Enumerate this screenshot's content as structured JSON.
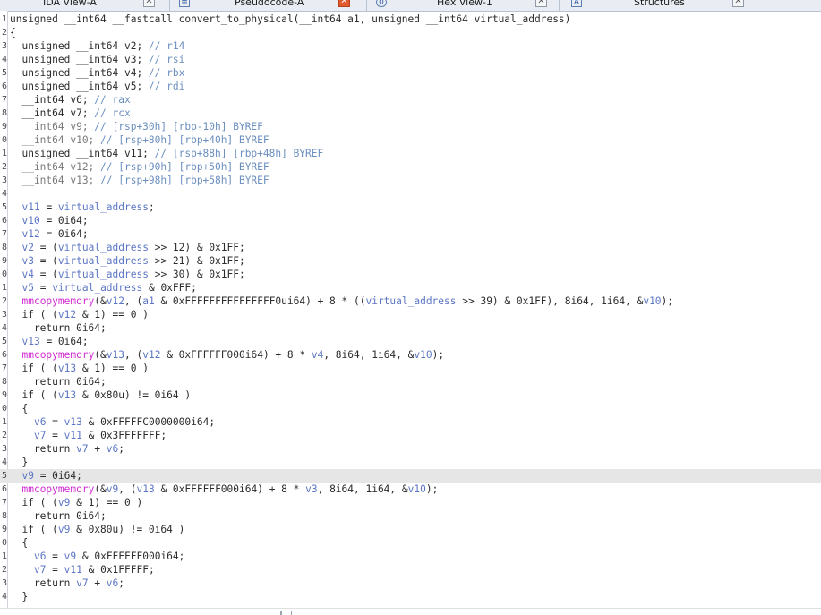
{
  "tabs": [
    {
      "label": "IDA View-A",
      "icon": "ida-view-icon",
      "closable": true,
      "active": false
    },
    {
      "label": "Pseudocode-A",
      "icon": "pseudocode-icon",
      "closable": true,
      "active": true
    },
    {
      "label": "Hex View-1",
      "icon": "hex-view-icon",
      "closable": true,
      "active": false
    },
    {
      "label": "Structures",
      "icon": "structures-icon",
      "closable": true,
      "active": false
    }
  ],
  "colors": {
    "code_text": "#2b2b2b",
    "comment": "#6b8fbf",
    "variable": "#5c76c4",
    "function": "#d12bd1",
    "highlight_line": "#e6e6e6",
    "active_tab_close": "#e25a2b"
  },
  "code": {
    "highlighted_line": 34,
    "lines": [
      {
        "n": "1",
        "parts": [
          [
            "c",
            "unsigned __int64 __fastcall convert_to_physical(__int64 a1, unsigned __int64 virtual_address)"
          ]
        ]
      },
      {
        "n": "2",
        "parts": [
          [
            "c",
            "{"
          ]
        ]
      },
      {
        "n": "3",
        "parts": [
          [
            "c",
            "  unsigned __int64 v2; "
          ],
          [
            "cm",
            "// r14"
          ]
        ]
      },
      {
        "n": "4",
        "parts": [
          [
            "c",
            "  unsigned __int64 v3; "
          ],
          [
            "cm",
            "// rsi"
          ]
        ]
      },
      {
        "n": "5",
        "parts": [
          [
            "c",
            "  unsigned __int64 v4; "
          ],
          [
            "cm",
            "// rbx"
          ]
        ]
      },
      {
        "n": "6",
        "parts": [
          [
            "c",
            "  unsigned __int64 v5; "
          ],
          [
            "cm",
            "// rdi"
          ]
        ]
      },
      {
        "n": "7",
        "parts": [
          [
            "c",
            "  __int64 v6; "
          ],
          [
            "cm",
            "// rax"
          ]
        ]
      },
      {
        "n": "8",
        "parts": [
          [
            "c",
            "  __int64 v7; "
          ],
          [
            "cm",
            "// rcx"
          ]
        ]
      },
      {
        "n": "9",
        "parts": [
          [
            "g",
            "  __int64 v9; "
          ],
          [
            "cm",
            "// [rsp+30h] [rbp-10h] BYREF"
          ]
        ]
      },
      {
        "n": "0",
        "parts": [
          [
            "g",
            "  __int64 v10; "
          ],
          [
            "cm",
            "// [rsp+80h] [rbp+40h] BYREF"
          ]
        ]
      },
      {
        "n": "1",
        "parts": [
          [
            "c",
            "  unsigned __int64 v11; "
          ],
          [
            "cm",
            "// [rsp+88h] [rbp+48h] BYREF"
          ]
        ]
      },
      {
        "n": "2",
        "parts": [
          [
            "g",
            "  __int64 v12; "
          ],
          [
            "cm",
            "// [rsp+90h] [rbp+50h] BYREF"
          ]
        ]
      },
      {
        "n": "3",
        "parts": [
          [
            "g",
            "  __int64 v13; "
          ],
          [
            "cm",
            "// [rsp+98h] [rbp+58h] BYREF"
          ]
        ]
      },
      {
        "n": "4",
        "parts": [
          [
            "c",
            ""
          ]
        ]
      },
      {
        "n": "5",
        "parts": [
          [
            "c",
            "  "
          ],
          [
            "v",
            "v11"
          ],
          [
            "c",
            " = "
          ],
          [
            "v",
            "virtual_address"
          ],
          [
            "c",
            ";"
          ]
        ]
      },
      {
        "n": "6",
        "parts": [
          [
            "c",
            "  "
          ],
          [
            "v",
            "v10"
          ],
          [
            "c",
            " = 0i64;"
          ]
        ]
      },
      {
        "n": "7",
        "parts": [
          [
            "c",
            "  "
          ],
          [
            "v",
            "v12"
          ],
          [
            "c",
            " = 0i64;"
          ]
        ]
      },
      {
        "n": "8",
        "parts": [
          [
            "c",
            "  "
          ],
          [
            "v",
            "v2"
          ],
          [
            "c",
            " = ("
          ],
          [
            "v",
            "virtual_address"
          ],
          [
            "c",
            " >> 12) & 0x1FF;"
          ]
        ]
      },
      {
        "n": "9",
        "parts": [
          [
            "c",
            "  "
          ],
          [
            "v",
            "v3"
          ],
          [
            "c",
            " = ("
          ],
          [
            "v",
            "virtual_address"
          ],
          [
            "c",
            " >> 21) & 0x1FF;"
          ]
        ]
      },
      {
        "n": "0",
        "parts": [
          [
            "c",
            "  "
          ],
          [
            "v",
            "v4"
          ],
          [
            "c",
            " = ("
          ],
          [
            "v",
            "virtual_address"
          ],
          [
            "c",
            " >> 30) & 0x1FF;"
          ]
        ]
      },
      {
        "n": "1",
        "parts": [
          [
            "c",
            "  "
          ],
          [
            "v",
            "v5"
          ],
          [
            "c",
            " = "
          ],
          [
            "v",
            "virtual_address"
          ],
          [
            "c",
            " & 0xFFF;"
          ]
        ]
      },
      {
        "n": "2",
        "parts": [
          [
            "c",
            "  "
          ],
          [
            "f",
            "mmcopymemory"
          ],
          [
            "c",
            "(&"
          ],
          [
            "v",
            "v12"
          ],
          [
            "c",
            ", ("
          ],
          [
            "v",
            "a1"
          ],
          [
            "c",
            " & 0xFFFFFFFFFFFFFFF0ui64) + 8 * (("
          ],
          [
            "v",
            "virtual_address"
          ],
          [
            "c",
            " >> 39) & 0x1FF), 8i64, 1i64, &"
          ],
          [
            "v",
            "v10"
          ],
          [
            "c",
            ");"
          ]
        ]
      },
      {
        "n": "3",
        "parts": [
          [
            "c",
            "  if ( ("
          ],
          [
            "v",
            "v12"
          ],
          [
            "c",
            " & 1) == 0 )"
          ]
        ]
      },
      {
        "n": "4",
        "parts": [
          [
            "c",
            "    return 0i64;"
          ]
        ]
      },
      {
        "n": "5",
        "parts": [
          [
            "c",
            "  "
          ],
          [
            "v",
            "v13"
          ],
          [
            "c",
            " = 0i64;"
          ]
        ]
      },
      {
        "n": "6",
        "parts": [
          [
            "c",
            "  "
          ],
          [
            "f",
            "mmcopymemory"
          ],
          [
            "c",
            "(&"
          ],
          [
            "v",
            "v13"
          ],
          [
            "c",
            ", ("
          ],
          [
            "v",
            "v12"
          ],
          [
            "c",
            " & 0xFFFFFF000i64) + 8 * "
          ],
          [
            "v",
            "v4"
          ],
          [
            "c",
            ", 8i64, 1i64, &"
          ],
          [
            "v",
            "v10"
          ],
          [
            "c",
            ");"
          ]
        ]
      },
      {
        "n": "7",
        "parts": [
          [
            "c",
            "  if ( ("
          ],
          [
            "v",
            "v13"
          ],
          [
            "c",
            " & 1) == 0 )"
          ]
        ]
      },
      {
        "n": "8",
        "parts": [
          [
            "c",
            "    return 0i64;"
          ]
        ]
      },
      {
        "n": "9",
        "parts": [
          [
            "c",
            "  if ( ("
          ],
          [
            "v",
            "v13"
          ],
          [
            "c",
            " & 0x80u) != 0i64 )"
          ]
        ]
      },
      {
        "n": "0",
        "parts": [
          [
            "c",
            "  {"
          ]
        ]
      },
      {
        "n": "1",
        "parts": [
          [
            "c",
            "    "
          ],
          [
            "v",
            "v6"
          ],
          [
            "c",
            " = "
          ],
          [
            "v",
            "v13"
          ],
          [
            "c",
            " & 0xFFFFFC0000000i64;"
          ]
        ]
      },
      {
        "n": "2",
        "parts": [
          [
            "c",
            "    "
          ],
          [
            "v",
            "v7"
          ],
          [
            "c",
            " = "
          ],
          [
            "v",
            "v11"
          ],
          [
            "c",
            " & 0x3FFFFFFF;"
          ]
        ]
      },
      {
        "n": "3",
        "parts": [
          [
            "c",
            "    return "
          ],
          [
            "v",
            "v7"
          ],
          [
            "c",
            " + "
          ],
          [
            "v",
            "v6"
          ],
          [
            "c",
            ";"
          ]
        ]
      },
      {
        "n": "4",
        "parts": [
          [
            "c",
            "  }"
          ]
        ]
      },
      {
        "n": "5",
        "parts": [
          [
            "c",
            "  "
          ],
          [
            "v",
            "v9"
          ],
          [
            "c",
            " = 0i64;"
          ]
        ]
      },
      {
        "n": "6",
        "parts": [
          [
            "c",
            "  "
          ],
          [
            "f",
            "mmcopymemory"
          ],
          [
            "c",
            "(&"
          ],
          [
            "v",
            "v9"
          ],
          [
            "c",
            ", ("
          ],
          [
            "v",
            "v13"
          ],
          [
            "c",
            " & 0xFFFFFF000i64) + 8 * "
          ],
          [
            "v",
            "v3"
          ],
          [
            "c",
            ", 8i64, 1i64, &"
          ],
          [
            "v",
            "v10"
          ],
          [
            "c",
            ");"
          ]
        ]
      },
      {
        "n": "7",
        "parts": [
          [
            "c",
            "  if ( ("
          ],
          [
            "v",
            "v9"
          ],
          [
            "c",
            " & 1) == 0 )"
          ]
        ]
      },
      {
        "n": "8",
        "parts": [
          [
            "c",
            "    return 0i64;"
          ]
        ]
      },
      {
        "n": "9",
        "parts": [
          [
            "c",
            "  if ( ("
          ],
          [
            "v",
            "v9"
          ],
          [
            "c",
            " & 0x80u) != 0i64 )"
          ]
        ]
      },
      {
        "n": "0",
        "parts": [
          [
            "c",
            "  {"
          ]
        ]
      },
      {
        "n": "1",
        "parts": [
          [
            "c",
            "    "
          ],
          [
            "v",
            "v6"
          ],
          [
            "c",
            " = "
          ],
          [
            "v",
            "v9"
          ],
          [
            "c",
            " & 0xFFFFFF000i64;"
          ]
        ]
      },
      {
        "n": "2",
        "parts": [
          [
            "c",
            "    "
          ],
          [
            "v",
            "v7"
          ],
          [
            "c",
            " = "
          ],
          [
            "v",
            "v11"
          ],
          [
            "c",
            " & 0x1FFFFF;"
          ]
        ]
      },
      {
        "n": "3",
        "parts": [
          [
            "c",
            "    return "
          ],
          [
            "v",
            "v7"
          ],
          [
            "c",
            " + "
          ],
          [
            "v",
            "v6"
          ],
          [
            "c",
            ";"
          ]
        ]
      },
      {
        "n": "4",
        "parts": [
          [
            "c",
            "  }"
          ]
        ]
      }
    ]
  }
}
